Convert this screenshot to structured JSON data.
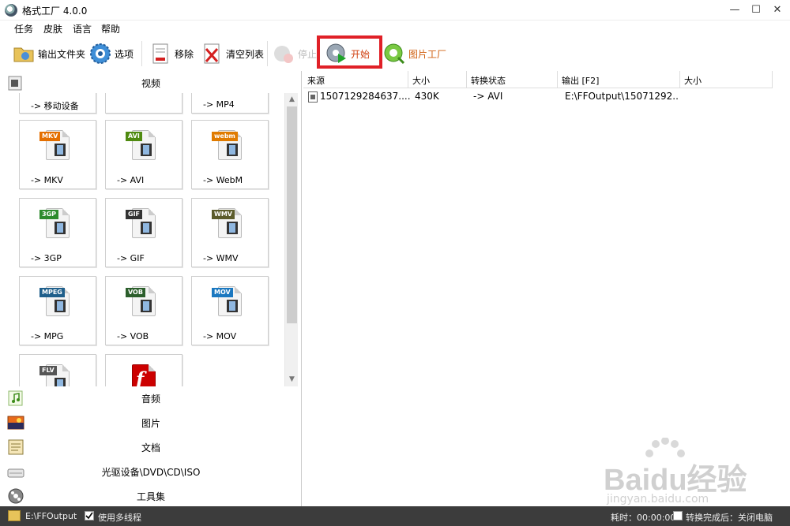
{
  "window": {
    "title": "格式工厂 4.0.0"
  },
  "menu": [
    "任务",
    "皮肤",
    "语言",
    "帮助"
  ],
  "toolbar": {
    "output_folder": "输出文件夹",
    "options": "选项",
    "remove": "移除",
    "clear_list": "清空列表",
    "stop": "停止",
    "start": "开始",
    "picture_factory": "图片工厂"
  },
  "left": {
    "video_label": "视频",
    "partial_row": [
      "-> 移动设备",
      "-> MP4"
    ],
    "tiles": [
      {
        "badge": "MKV",
        "label": "-> MKV",
        "color": "#e46f00"
      },
      {
        "badge": "AVI",
        "label": "-> AVI",
        "color": "#4f8a10"
      },
      {
        "badge": "webm",
        "label": "-> WebM",
        "color": "#e07b00"
      },
      {
        "badge": "3GP",
        "label": "-> 3GP",
        "color": "#2e8b2e"
      },
      {
        "badge": "GIF",
        "label": "-> GIF",
        "color": "#333333"
      },
      {
        "badge": "WMV",
        "label": "-> WMV",
        "color": "#5b5b2b"
      },
      {
        "badge": "MPEG",
        "label": "-> MPG",
        "color": "#1f5f8b"
      },
      {
        "badge": "VOB",
        "label": "-> VOB",
        "color": "#2b5e2b"
      },
      {
        "badge": "MOV",
        "label": "-> MOV",
        "color": "#1b78c0"
      },
      {
        "badge": "FLV",
        "label": "",
        "color": "#555555"
      },
      {
        "badge": "",
        "label": "",
        "color": "#cc0000"
      }
    ],
    "categories": [
      "音频",
      "图片",
      "文档",
      "光驱设备\\DVD\\CD\\ISO",
      "工具集"
    ]
  },
  "table": {
    "headers": [
      "来源",
      "大小",
      "转换状态",
      "输出 [F2]",
      "大小"
    ],
    "rows": [
      {
        "source": "1507129284637....",
        "size": "430K",
        "status": "-> AVI",
        "output": "E:\\FFOutput\\15071292...",
        "out_size": ""
      }
    ]
  },
  "status": {
    "output_path": "E:\\FFOutput",
    "multithread": "使用多线程",
    "elapsed": "耗时：00:00:00",
    "after_convert": "转换完成后：关闭电脑"
  },
  "watermark": {
    "brand": "Baidu经验",
    "url": "jingyan.baidu.com"
  }
}
